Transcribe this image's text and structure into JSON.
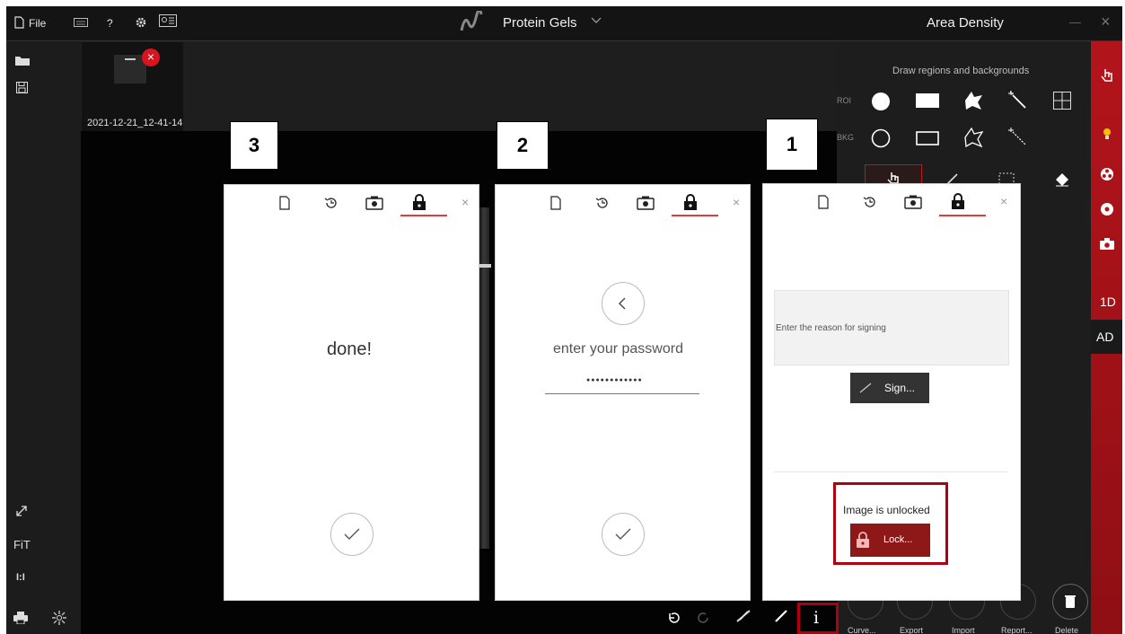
{
  "topbar": {
    "file_label": "File",
    "help_label": "?",
    "title": "Protein Gels",
    "module": "Area Density",
    "minimize": "—",
    "close": "×"
  },
  "thumbnail": {
    "caption": "2021-12-21_12-41-14",
    "remove": "×"
  },
  "leftbar": {
    "fit_label": "FiT",
    "one_to_one_label": "I:I"
  },
  "right_panel": {
    "heading": "Draw regions and backgrounds",
    "roi_label": "ROI",
    "bkg_label": "BKG"
  },
  "red_sidebar": {
    "tab_1d": "1D",
    "tab_ad": "AD"
  },
  "bottom_actions": [
    "Curve...",
    "Export",
    "Import",
    "Report...",
    "Delete"
  ],
  "info_glyph": "i",
  "dialog1": {
    "number": "1",
    "reason_placeholder": "Enter the reason for signing",
    "sign_label": "Sign...",
    "status": "Image is unlocked",
    "lock_label": "Lock..."
  },
  "dialog2": {
    "number": "2",
    "prompt": "enter your password",
    "password_mask": "●●●●●●●●●●●●"
  },
  "dialog3": {
    "number": "3",
    "message": "done!"
  },
  "colors": {
    "accent_red": "#c0141b",
    "highlight_box": "#b00010",
    "tab_underline": "#e43a3a"
  }
}
